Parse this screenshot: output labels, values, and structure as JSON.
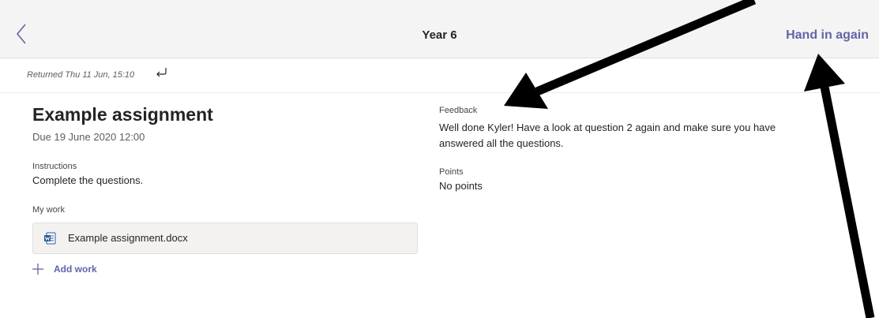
{
  "header": {
    "title": "Year 6",
    "hand_in_label": "Hand in again"
  },
  "status": {
    "returned_text": "Returned Thu 11 Jun, 15:10"
  },
  "assignment": {
    "title": "Example assignment",
    "due": "Due 19 June 2020 12:00",
    "instructions_label": "Instructions",
    "instructions": "Complete the questions.",
    "my_work_label": "My work",
    "file_name": "Example assignment.docx",
    "add_work_label": "Add work"
  },
  "feedback": {
    "label": "Feedback",
    "text": "Well done Kyler! Have a look at question 2 again and make sure you have answered all the questions.",
    "points_label": "Points",
    "points_value": "No points"
  },
  "colors": {
    "accent": "#6264a7",
    "word_blue": "#2b579a",
    "annotation": "#000000"
  }
}
